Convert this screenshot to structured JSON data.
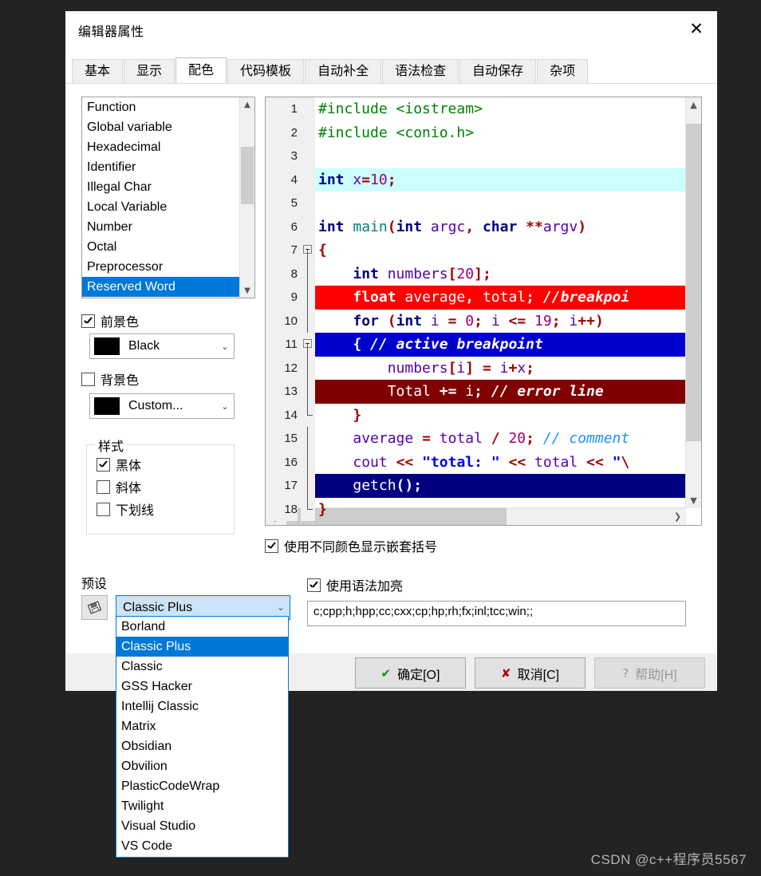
{
  "window": {
    "title": "编辑器属性",
    "close_icon": "close-icon"
  },
  "tabs": [
    {
      "label": "基本",
      "active": false
    },
    {
      "label": "显示",
      "active": false
    },
    {
      "label": "配色",
      "active": true
    },
    {
      "label": "代码模板",
      "active": false
    },
    {
      "label": "自动补全",
      "active": false
    },
    {
      "label": "语法检查",
      "active": false
    },
    {
      "label": "自动保存",
      "active": false
    },
    {
      "label": "杂项",
      "active": false
    }
  ],
  "element_list": {
    "items": [
      "Function",
      "Global variable",
      "Hexadecimal",
      "Identifier",
      "Illegal Char",
      "Local Variable",
      "Number",
      "Octal",
      "Preprocessor",
      "Reserved Word"
    ],
    "selected": "Reserved Word",
    "scroll_up_icon": "chevron-up-icon",
    "scroll_down_icon": "chevron-down-icon"
  },
  "foreground": {
    "checkbox_label": "前景色",
    "checked": true,
    "color_name": "Black",
    "color_hex": "#000000",
    "arrow_icon": "chevron-down-icon"
  },
  "background": {
    "checkbox_label": "背景色",
    "checked": false,
    "color_name": "Custom...",
    "color_hex": "#000000",
    "arrow_icon": "chevron-down-icon"
  },
  "style_group": {
    "title": "样式",
    "options": [
      {
        "label": "黑体",
        "checked": true
      },
      {
        "label": "斜体",
        "checked": false
      },
      {
        "label": "下划线",
        "checked": false
      }
    ]
  },
  "preset": {
    "label": "预设",
    "save_icon": "save-floppy-icon",
    "selected": "Classic Plus",
    "arrow_icon": "chevron-down-icon",
    "options": [
      "Borland",
      "Classic Plus",
      "Classic",
      "GSS Hacker",
      "Intellij Classic",
      "Matrix",
      "Obsidian",
      "Obvilion",
      "PlasticCodeWrap",
      "Twilight",
      "Visual Studio",
      "VS Code"
    ]
  },
  "options": {
    "nested_brackets": {
      "label": "使用不同颜色显示嵌套括号",
      "checked": true
    },
    "syntax_highlight": {
      "label": "使用语法加亮",
      "checked": true
    },
    "extensions_value": "c;cpp;h;hpp;cc;cxx;cp;hp;rh;fx;inl;tcc;win;;"
  },
  "buttons": {
    "ok": {
      "label": "确定[O]",
      "icon": "check-icon",
      "disabled": false
    },
    "cancel": {
      "label": "取消[C]",
      "icon": "cross-icon",
      "disabled": false
    },
    "help": {
      "label": "帮助[H]",
      "icon": "question-icon",
      "disabled": true
    }
  },
  "editor_preview": {
    "scroll_up_icon": "chevron-up-icon",
    "scroll_down_icon": "chevron-down-icon",
    "scroll_left_icon": "chevron-left-icon",
    "scroll_right_icon": "chevron-right-icon",
    "lines": [
      {
        "n": "1",
        "fold": "none",
        "bg": "",
        "text": "#include <iostream>"
      },
      {
        "n": "2",
        "fold": "none",
        "bg": "",
        "text": "#include <conio.h>"
      },
      {
        "n": "3",
        "fold": "none",
        "bg": "",
        "text": ""
      },
      {
        "n": "4",
        "fold": "none",
        "bg": "#ccffff",
        "text": "int x=10;"
      },
      {
        "n": "5",
        "fold": "none",
        "bg": "",
        "text": ""
      },
      {
        "n": "6",
        "fold": "none",
        "bg": "",
        "text": "int main(int argc, char **argv)"
      },
      {
        "n": "7",
        "fold": "open",
        "bg": "",
        "text": "{"
      },
      {
        "n": "8",
        "fold": "line",
        "bg": "",
        "text": "    int numbers[20];"
      },
      {
        "n": "9",
        "fold": "line",
        "bg": "#ff0000",
        "text": "    float average, total; //breakpoi"
      },
      {
        "n": "10",
        "fold": "line",
        "bg": "",
        "text": "    for (int i = 0; i <= 19; i++)"
      },
      {
        "n": "11",
        "fold": "open2",
        "bg": "#0000cc",
        "text": "    { // active breakpoint"
      },
      {
        "n": "12",
        "fold": "line",
        "bg": "",
        "text": "        numbers[i] = i+x;"
      },
      {
        "n": "13",
        "fold": "line",
        "bg": "#800000",
        "text": "        Total += i; // error line"
      },
      {
        "n": "14",
        "fold": "end2",
        "bg": "",
        "text": "    }"
      },
      {
        "n": "15",
        "fold": "line",
        "bg": "",
        "text": "    average = total / 20; // comment"
      },
      {
        "n": "16",
        "fold": "line",
        "bg": "",
        "text": "    cout << \"total: \" << total << \"\\"
      },
      {
        "n": "17",
        "fold": "line",
        "bg": "#000080",
        "text": "    getch();"
      },
      {
        "n": "18",
        "fold": "end",
        "bg": "",
        "text": "}"
      }
    ]
  },
  "watermark": "CSDN @c++程序员5567"
}
